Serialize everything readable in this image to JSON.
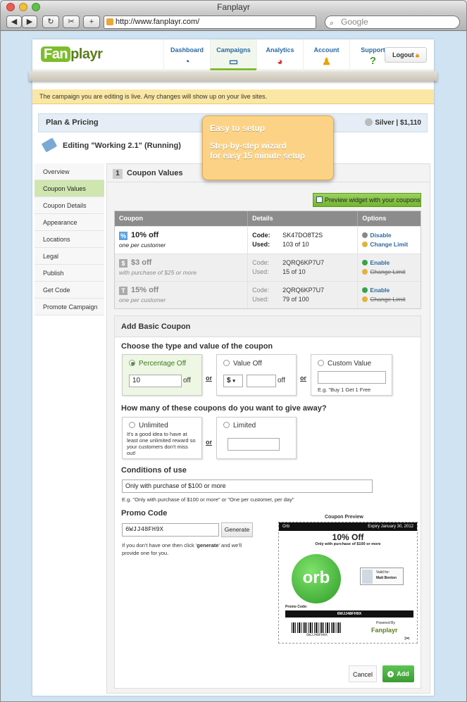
{
  "window": {
    "title": "Fanplayr"
  },
  "browser": {
    "url": "http://www.fanplayr.com/",
    "search_placeholder": "Google"
  },
  "header": {
    "logo": "Fanplayr",
    "nav": [
      {
        "label": "Dashboard",
        "icon": "gauge-icon"
      },
      {
        "label": "Campaigns",
        "icon": "chat-icon"
      },
      {
        "label": "Analytics",
        "icon": "pie-chart-icon"
      },
      {
        "label": "Account",
        "icon": "user-icon"
      },
      {
        "label": "Support",
        "icon": "question-icon"
      }
    ],
    "logout": "Logout"
  },
  "notice": "The campaign you are editing is live. Any changes will show up on your live sites.",
  "plan": {
    "title": "Plan & Pricing",
    "tier": "Silver | $1,110"
  },
  "editing": "Editing \"Working 2.1\" (Running)",
  "tooltip": {
    "title": "Easy to setup",
    "line1": "Step-by-step wizard",
    "line2": "for easy 15 minute setup"
  },
  "sidebar": [
    "Overview",
    "Coupon Values",
    "Coupon Details",
    "Appearance",
    "Locations",
    "Legal",
    "Publish",
    "Get Code",
    "Promote Campaign"
  ],
  "section": {
    "number": "1",
    "title": "Coupon Values",
    "preview_button": "Preview widget with your coupons"
  },
  "table": {
    "headers": [
      "Coupon",
      "Details",
      "Options"
    ],
    "code_label": "Code:",
    "used_label": "Used:",
    "rows": [
      {
        "icon": "%",
        "value": "10% off",
        "desc": "one per customer",
        "code": "SK47DO8T2S",
        "used": "103 of 10",
        "opt1": "Disable",
        "opt2": "Change Limit"
      },
      {
        "icon": "$",
        "value": "$3 off",
        "desc": "with purchase of $25 or more",
        "code": "2QRQ6KP7U7",
        "used": "15 of 10",
        "opt1": "Enable",
        "opt2": "Change Limit"
      },
      {
        "icon": "T",
        "value": "15% off",
        "desc": "one per customer",
        "code": "2QRQ6KP7U7",
        "used": "79 of 100",
        "opt1": "Enable",
        "opt2": "Change Limit"
      }
    ]
  },
  "form": {
    "title": "Add Basic Coupon",
    "q_type": "Choose the type and value of the coupon",
    "pct_label": "Percentage Off",
    "pct_value": "10",
    "off": "off",
    "value_off_label": "Value Off",
    "currency": "$",
    "custom_label": "Custom Value",
    "custom_hint": "E.g. \"Buy 1 Get 1 Free",
    "or": "or",
    "q_count": "How many of these coupons do you want to give away?",
    "unlimited": "Unlimited",
    "unlimited_hint": "It's a good idea to have at least one unlimited reward so your customers don't miss out!",
    "limited": "Limited",
    "q_cond": "Conditions of use",
    "cond_value": "Only with purchase of $100 or more",
    "cond_hint": "E.g. \"Only with purchase of $100 or more\" or \"One per customer, per day\"",
    "q_promo": "Promo Code",
    "promo_value": "6WJJ48FH9X",
    "generate": "Generate",
    "promo_hint_a": "If you don't have one then click '",
    "promo_hint_b": "generate",
    "promo_hint_c": "' and we'll provide one for you.",
    "cancel": "Cancel",
    "add": "Add"
  },
  "preview": {
    "title": "Coupon Preview",
    "brand": "Orb",
    "expiry": "Expiry January 30, 2012",
    "headline": "10% Off",
    "subline": "Only with purchase of $100 or more",
    "logo_text": "orb",
    "valid_for": "Valid for:",
    "name": "Matt Benton",
    "promo_label": "Promo Code:",
    "promo": "6WJJ48FH9X",
    "barcode_text": "6WJJ48FH9X",
    "powered": "Powered By",
    "powered_brand": "Fanplayr"
  },
  "colors": {
    "accent_green": "#7dbd2b",
    "notice_yellow": "#fbe7a4",
    "link_blue": "#2d6a9f",
    "tooltip": "#fcd386"
  }
}
